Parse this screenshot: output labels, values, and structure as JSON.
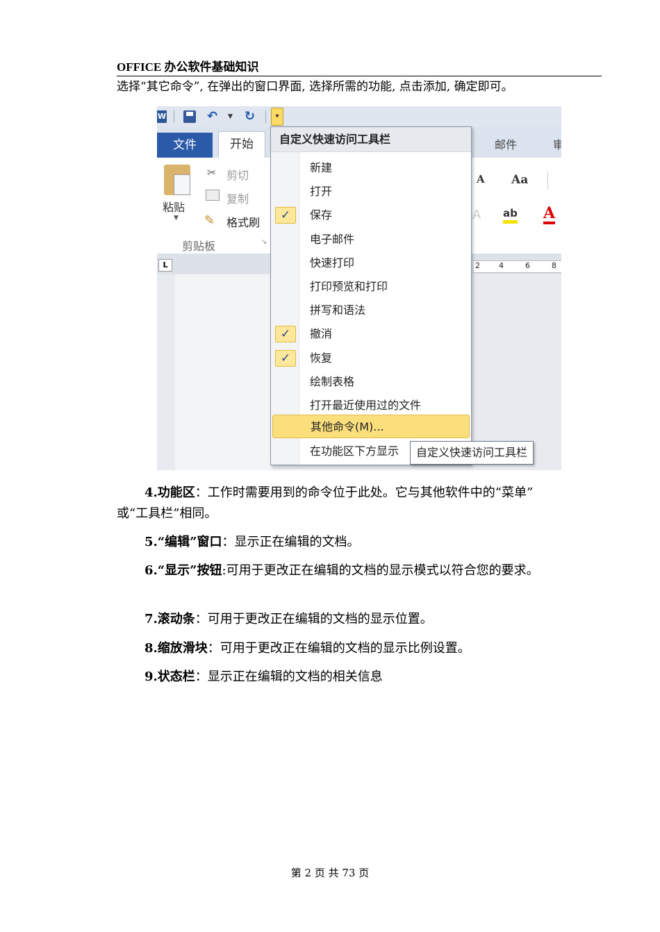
{
  "header": {
    "title": "OFFICE 办公软件基础知识"
  },
  "intro": "选择“其它命令”, 在弹出的窗口界面, 选择所需的功能, 点击添加, 确定即可。",
  "screenshot": {
    "word_logo": "W",
    "tabs": {
      "file": "文件",
      "home": "开始",
      "mail": "邮件",
      "review": "审"
    },
    "clipboard": {
      "paste": "粘贴",
      "cut": "剪切",
      "copy": "复制",
      "format_painter": "格式刷",
      "group_label": "剪贴板"
    },
    "font_glyphs": {
      "grow": "A",
      "change_case": "Aa",
      "highlight": "ab",
      "color": "A"
    },
    "tab_selector": "L",
    "ruler": [
      "2",
      "4",
      "6",
      "8"
    ],
    "menu": {
      "title": "自定义快速访问工具栏",
      "items": [
        {
          "label": "新建",
          "checked": false
        },
        {
          "label": "打开",
          "checked": false
        },
        {
          "label": "保存",
          "checked": true
        },
        {
          "label": "电子邮件",
          "checked": false
        },
        {
          "label": "快速打印",
          "checked": false
        },
        {
          "label": "打印预览和打印",
          "checked": false
        },
        {
          "label": "拼写和语法",
          "checked": false
        },
        {
          "label": "撤消",
          "checked": true
        },
        {
          "label": "恢复",
          "checked": true
        },
        {
          "label": "绘制表格",
          "checked": false
        },
        {
          "label": "打开最近使用过的文件",
          "checked": false
        }
      ],
      "more_commands": "其他命令(M)...",
      "show_below": "在功能区下方显示"
    },
    "tooltip": "自定义快速访问工具栏",
    "colors": {
      "accent": "#2a5aa8",
      "highlight": "#fcdf7d"
    }
  },
  "items": [
    {
      "num": "4.",
      "title": "功能区",
      "sep": "：",
      "text": "工作时需要用到的命令位于此处。它与其他软件中的“菜单”",
      "cont": "或“工具栏”相同。"
    },
    {
      "num": "5.",
      "title": "“编辑”窗口",
      "sep": "：",
      "text": "显示正在编辑的文档。"
    },
    {
      "num": "6.",
      "title": "“显示”按钮",
      "sep": ":",
      "text": "可用于更改正在编辑的文档的显示模式以符合您的要求。"
    },
    {
      "num": "7.",
      "title": "滚动条",
      "sep": "：",
      "text": "可用于更改正在编辑的文档的显示位置。"
    },
    {
      "num": "8.",
      "title": "缩放滑块",
      "sep": "：",
      "text": "可用于更改正在编辑的文档的显示比例设置。"
    },
    {
      "num": "9.",
      "title": "状态栏",
      "sep": "：",
      "text": "显示正在编辑的文档的相关信息"
    }
  ],
  "footer": "第 2 页  共 73 页"
}
